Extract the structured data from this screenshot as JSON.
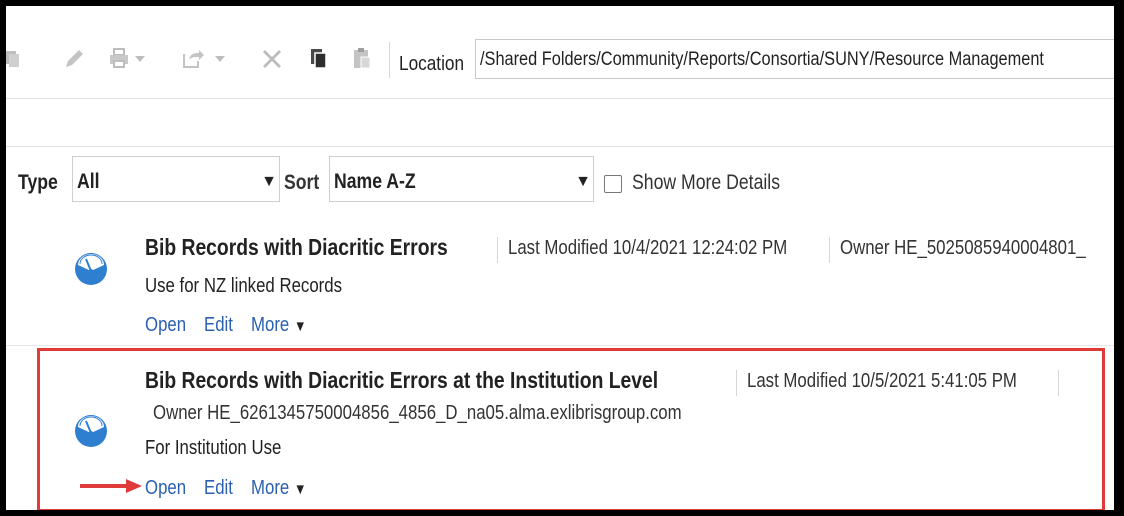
{
  "toolbar": {
    "icons": [
      "copy-icon",
      "pencil-icon",
      "print-icon",
      "share-icon",
      "delete-icon",
      "duplicate-icon",
      "paste-icon"
    ],
    "location_label": "Location",
    "location_value": "/Shared Folders/Community/Reports/Consortia/SUNY/Resource Management"
  },
  "filters": {
    "type_label": "Type",
    "type_value": "All",
    "sort_label": "Sort",
    "sort_value": "Name A-Z",
    "show_more_label": "Show More Details",
    "show_more_checked": false
  },
  "items": [
    {
      "title": "Bib Records with Diacritic Errors",
      "last_modified": "Last Modified 10/4/2021 12:24:02 PM",
      "owner": "Owner HE_5025085940004801_",
      "description": "Use for NZ linked Records",
      "actions": {
        "open": "Open",
        "edit": "Edit",
        "more": "More ▼"
      }
    },
    {
      "title": "Bib Records with Diacritic Errors at the Institution Level",
      "last_modified": "Last Modified 10/5/2021 5:41:05 PM",
      "owner": "Owner HE_6261345750004856_4856_D_na05.alma.exlibrisgroup.com",
      "description": "For Institution Use",
      "actions": {
        "open": "Open",
        "edit": "Edit",
        "more": "More ▼"
      }
    }
  ],
  "colors": {
    "link": "#2b5fb0",
    "highlight": "#e03b3b",
    "icon": "#2f7fd1"
  }
}
